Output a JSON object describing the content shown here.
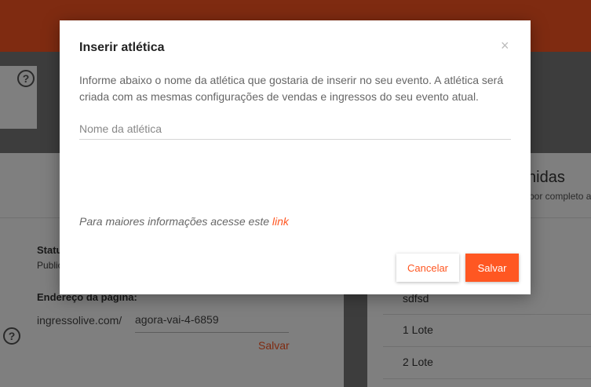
{
  "background": {
    "status_label": "Status",
    "status_value": "Publicado",
    "address_label": "Endereço da página:",
    "url_prefix": "ingressolive.com/",
    "slug_value": "agora-vai-4-6859",
    "save_link": "Salvar",
    "panel_title_partial": "nidas",
    "panel_subtitle_partial": "por completo a",
    "list_items": [
      "sdfsd",
      "1 Lote",
      "2 Lote"
    ]
  },
  "modal": {
    "title": "Inserir atlética",
    "close_glyph": "×",
    "description": "Informe abaixo o nome da atlética que gostaria de inserir no seu evento. A atlética será criada com as mesmas configurações de vendas e ingressos do seu evento atual.",
    "input_placeholder": "Nome da atlética",
    "input_value": "",
    "info_text": "Para maiores informações acesse este ",
    "info_link": "link",
    "cancel_label": "Cancelar",
    "save_label": "Salvar"
  },
  "colors": {
    "accent": "#ff5722",
    "overlay": "rgba(0,0,0,0.5)"
  },
  "icons": {
    "help": "question-circle-icon",
    "close": "close-icon"
  }
}
